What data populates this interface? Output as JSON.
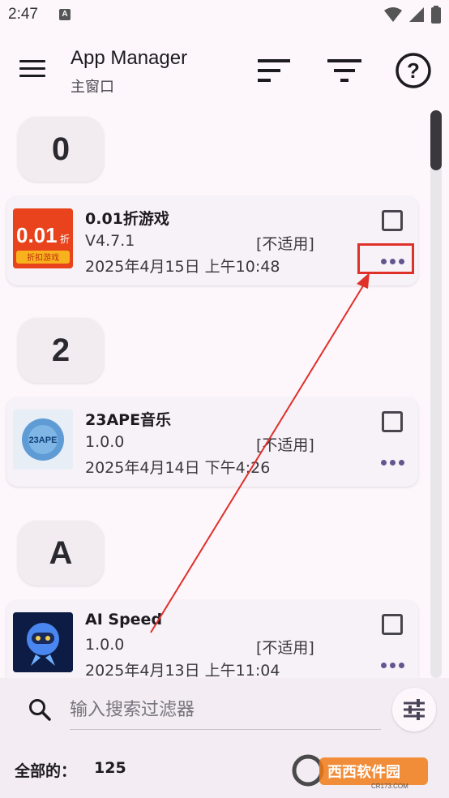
{
  "status_bar": {
    "time": "2:47",
    "a_badge": "A"
  },
  "app_bar": {
    "title": "App Manager",
    "subtitle": "主窗口"
  },
  "sections": [
    {
      "letter": "0"
    },
    {
      "letter": "2"
    },
    {
      "letter": "A"
    }
  ],
  "apps": [
    {
      "name": "0.01折游戏",
      "version": "V4.7.1",
      "status": "[不适用]",
      "date": "2025年4月15日 上午10:48",
      "icon": "game-discount-icon",
      "icon_text_top": "0.01",
      "icon_text_small": "折",
      "icon_text_bottom": "折扣游戏"
    },
    {
      "name": "23APE音乐",
      "version": "1.0.0",
      "status": "[不适用]",
      "date": "2025年4月14日 下午4:26",
      "icon": "music-globe-icon",
      "icon_text_top": "23APE"
    },
    {
      "name": "AI Speed",
      "version": "1.0.0",
      "status": "[不适用]",
      "date": "2025年4月13日 上午11:04",
      "icon": "robot-icon"
    }
  ],
  "search": {
    "placeholder": "输入搜索过滤器"
  },
  "footer": {
    "total_label": "全部的：",
    "total_value": "125"
  },
  "watermark": {
    "text": "西西软件园",
    "subtext": "CR173.COM"
  },
  "colors": {
    "background": "#fdf7fc",
    "accent": "#65558f",
    "highlight": "#e0302a"
  }
}
